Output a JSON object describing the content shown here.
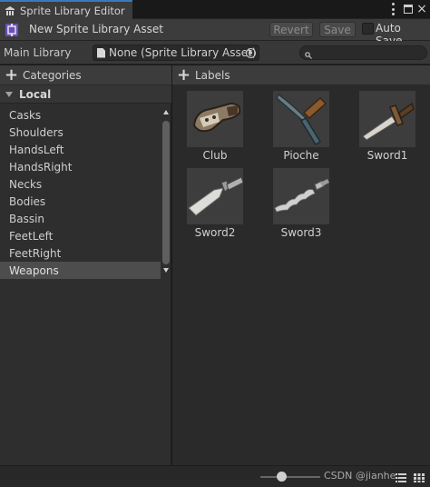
{
  "window": {
    "tab_title": "Sprite Library Editor"
  },
  "toolbar": {
    "asset_title": "New Sprite Library Asset",
    "revert_label": "Revert",
    "save_label": "Save",
    "autosave_label": "Auto Save",
    "autosave_checked": false
  },
  "library": {
    "label": "Main Library",
    "value": "None (Sprite Library Asset)",
    "search_value": ""
  },
  "categories": {
    "header": "Categories",
    "group": "Local",
    "items": [
      "Casks",
      "Shoulders",
      "HandsLeft",
      "HandsRight",
      "Necks",
      "Bodies",
      "Bassin",
      "FeetLeft",
      "FeetRight",
      "Weapons"
    ],
    "selected": "Weapons"
  },
  "labels": {
    "header": "Labels",
    "items": [
      "Club",
      "Pioche",
      "Sword1",
      "Sword2",
      "Sword3"
    ]
  },
  "footer": {
    "zoom_level": 0.35,
    "watermark": "CSDN @jianhe..."
  },
  "colors": {
    "accent": "#3a79bb",
    "selected_row": "#4d4d4d"
  }
}
